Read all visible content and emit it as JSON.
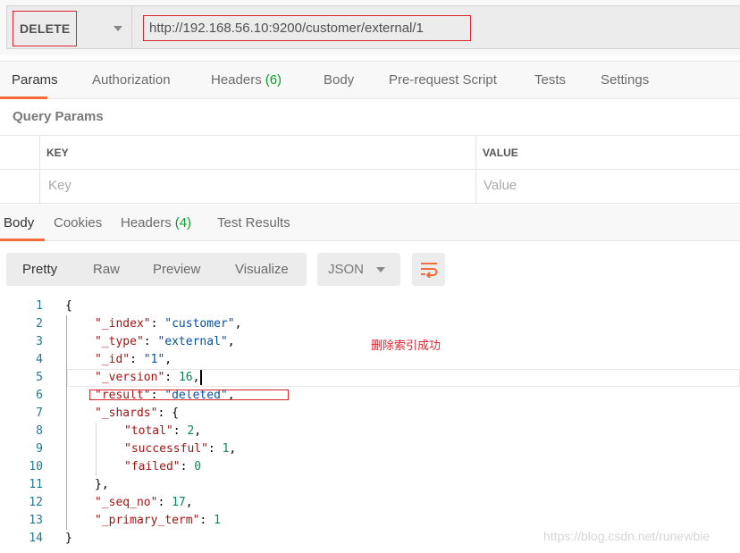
{
  "request": {
    "method": "DELETE",
    "url": "http://192.168.56.10:9200/customer/external/1"
  },
  "request_tabs": [
    {
      "label": "Params",
      "count": null,
      "active": true
    },
    {
      "label": "Authorization",
      "count": null,
      "active": false
    },
    {
      "label": "Headers",
      "count": "(6)",
      "active": false
    },
    {
      "label": "Body",
      "count": null,
      "active": false
    },
    {
      "label": "Pre-request Script",
      "count": null,
      "active": false
    },
    {
      "label": "Tests",
      "count": null,
      "active": false
    },
    {
      "label": "Settings",
      "count": null,
      "active": false
    }
  ],
  "query_params": {
    "title": "Query Params",
    "columns": [
      "KEY",
      "VALUE"
    ],
    "placeholder_row": {
      "key": "Key",
      "value": "Value"
    }
  },
  "response_tabs": [
    {
      "label": "Body",
      "count": null,
      "active": true
    },
    {
      "label": "Cookies",
      "count": null,
      "active": false
    },
    {
      "label": "Headers",
      "count": "(4)",
      "active": false
    },
    {
      "label": "Test Results",
      "count": null,
      "active": false
    }
  ],
  "format_bar": {
    "views": [
      "Pretty",
      "Raw",
      "Preview",
      "Visualize"
    ],
    "active_view": "Pretty",
    "language": "JSON",
    "wrap_icon": "wrap-lines-icon"
  },
  "response_body": {
    "lines": [
      {
        "n": "1",
        "indent": 0,
        "tokens": [
          {
            "t": "p",
            "v": "{"
          }
        ]
      },
      {
        "n": "2",
        "indent": 1,
        "tokens": [
          {
            "t": "k",
            "v": "\"_index\""
          },
          {
            "t": "p",
            "v": ": "
          },
          {
            "t": "s",
            "v": "\"customer\""
          },
          {
            "t": "p",
            "v": ","
          }
        ]
      },
      {
        "n": "3",
        "indent": 1,
        "tokens": [
          {
            "t": "k",
            "v": "\"_type\""
          },
          {
            "t": "p",
            "v": ": "
          },
          {
            "t": "s",
            "v": "\"external\""
          },
          {
            "t": "p",
            "v": ","
          }
        ]
      },
      {
        "n": "4",
        "indent": 1,
        "tokens": [
          {
            "t": "k",
            "v": "\"_id\""
          },
          {
            "t": "p",
            "v": ": "
          },
          {
            "t": "s",
            "v": "\"1\""
          },
          {
            "t": "p",
            "v": ","
          }
        ]
      },
      {
        "n": "5",
        "indent": 1,
        "tokens": [
          {
            "t": "k",
            "v": "\"_version\""
          },
          {
            "t": "p",
            "v": ": "
          },
          {
            "t": "n",
            "v": "16"
          },
          {
            "t": "p",
            "v": ","
          }
        ],
        "cursor": true
      },
      {
        "n": "6",
        "indent": 1,
        "tokens": [
          {
            "t": "k",
            "v": "\"result\""
          },
          {
            "t": "p",
            "v": ": "
          },
          {
            "t": "s",
            "v": "\"deleted\""
          },
          {
            "t": "p",
            "v": ","
          }
        ]
      },
      {
        "n": "7",
        "indent": 1,
        "tokens": [
          {
            "t": "k",
            "v": "\"_shards\""
          },
          {
            "t": "p",
            "v": ": {"
          }
        ]
      },
      {
        "n": "8",
        "indent": 2,
        "tokens": [
          {
            "t": "k",
            "v": "\"total\""
          },
          {
            "t": "p",
            "v": ": "
          },
          {
            "t": "n",
            "v": "2"
          },
          {
            "t": "p",
            "v": ","
          }
        ]
      },
      {
        "n": "9",
        "indent": 2,
        "tokens": [
          {
            "t": "k",
            "v": "\"successful\""
          },
          {
            "t": "p",
            "v": ": "
          },
          {
            "t": "n",
            "v": "1"
          },
          {
            "t": "p",
            "v": ","
          }
        ]
      },
      {
        "n": "10",
        "indent": 2,
        "tokens": [
          {
            "t": "k",
            "v": "\"failed\""
          },
          {
            "t": "p",
            "v": ": "
          },
          {
            "t": "n",
            "v": "0"
          }
        ]
      },
      {
        "n": "11",
        "indent": 1,
        "tokens": [
          {
            "t": "p",
            "v": "},"
          }
        ]
      },
      {
        "n": "12",
        "indent": 1,
        "tokens": [
          {
            "t": "k",
            "v": "\"_seq_no\""
          },
          {
            "t": "p",
            "v": ": "
          },
          {
            "t": "n",
            "v": "17"
          },
          {
            "t": "p",
            "v": ","
          }
        ]
      },
      {
        "n": "13",
        "indent": 1,
        "tokens": [
          {
            "t": "k",
            "v": "\"_primary_term\""
          },
          {
            "t": "p",
            "v": ": "
          },
          {
            "t": "n",
            "v": "1"
          }
        ]
      },
      {
        "n": "14",
        "indent": 0,
        "tokens": [
          {
            "t": "p",
            "v": "}"
          }
        ]
      }
    ]
  },
  "annotation": "删除索引成功",
  "watermark": "https://blog.csdn.net/runewbie",
  "colors": {
    "accent": "#f26b3a",
    "highlight_box": "#d9232d",
    "count_green": "#0c9e2c",
    "json_key": "#a31515",
    "json_string": "#0451a5",
    "json_number": "#098658",
    "line_number": "#237893"
  }
}
